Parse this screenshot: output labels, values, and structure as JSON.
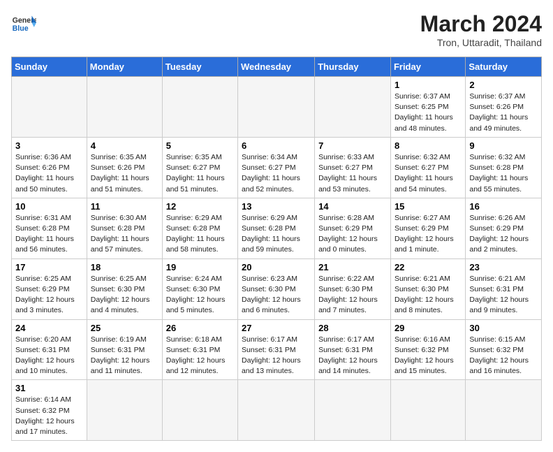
{
  "header": {
    "logo_general": "General",
    "logo_blue": "Blue",
    "month_title": "March 2024",
    "subtitle": "Tron, Uttaradit, Thailand"
  },
  "days_of_week": [
    "Sunday",
    "Monday",
    "Tuesday",
    "Wednesday",
    "Thursday",
    "Friday",
    "Saturday"
  ],
  "weeks": [
    [
      {
        "day": "",
        "info": ""
      },
      {
        "day": "",
        "info": ""
      },
      {
        "day": "",
        "info": ""
      },
      {
        "day": "",
        "info": ""
      },
      {
        "day": "",
        "info": ""
      },
      {
        "day": "1",
        "info": "Sunrise: 6:37 AM\nSunset: 6:25 PM\nDaylight: 11 hours\nand 48 minutes."
      },
      {
        "day": "2",
        "info": "Sunrise: 6:37 AM\nSunset: 6:26 PM\nDaylight: 11 hours\nand 49 minutes."
      }
    ],
    [
      {
        "day": "3",
        "info": "Sunrise: 6:36 AM\nSunset: 6:26 PM\nDaylight: 11 hours\nand 50 minutes."
      },
      {
        "day": "4",
        "info": "Sunrise: 6:35 AM\nSunset: 6:26 PM\nDaylight: 11 hours\nand 51 minutes."
      },
      {
        "day": "5",
        "info": "Sunrise: 6:35 AM\nSunset: 6:27 PM\nDaylight: 11 hours\nand 51 minutes."
      },
      {
        "day": "6",
        "info": "Sunrise: 6:34 AM\nSunset: 6:27 PM\nDaylight: 11 hours\nand 52 minutes."
      },
      {
        "day": "7",
        "info": "Sunrise: 6:33 AM\nSunset: 6:27 PM\nDaylight: 11 hours\nand 53 minutes."
      },
      {
        "day": "8",
        "info": "Sunrise: 6:32 AM\nSunset: 6:27 PM\nDaylight: 11 hours\nand 54 minutes."
      },
      {
        "day": "9",
        "info": "Sunrise: 6:32 AM\nSunset: 6:28 PM\nDaylight: 11 hours\nand 55 minutes."
      }
    ],
    [
      {
        "day": "10",
        "info": "Sunrise: 6:31 AM\nSunset: 6:28 PM\nDaylight: 11 hours\nand 56 minutes."
      },
      {
        "day": "11",
        "info": "Sunrise: 6:30 AM\nSunset: 6:28 PM\nDaylight: 11 hours\nand 57 minutes."
      },
      {
        "day": "12",
        "info": "Sunrise: 6:29 AM\nSunset: 6:28 PM\nDaylight: 11 hours\nand 58 minutes."
      },
      {
        "day": "13",
        "info": "Sunrise: 6:29 AM\nSunset: 6:28 PM\nDaylight: 11 hours\nand 59 minutes."
      },
      {
        "day": "14",
        "info": "Sunrise: 6:28 AM\nSunset: 6:29 PM\nDaylight: 12 hours\nand 0 minutes."
      },
      {
        "day": "15",
        "info": "Sunrise: 6:27 AM\nSunset: 6:29 PM\nDaylight: 12 hours\nand 1 minute."
      },
      {
        "day": "16",
        "info": "Sunrise: 6:26 AM\nSunset: 6:29 PM\nDaylight: 12 hours\nand 2 minutes."
      }
    ],
    [
      {
        "day": "17",
        "info": "Sunrise: 6:25 AM\nSunset: 6:29 PM\nDaylight: 12 hours\nand 3 minutes."
      },
      {
        "day": "18",
        "info": "Sunrise: 6:25 AM\nSunset: 6:30 PM\nDaylight: 12 hours\nand 4 minutes."
      },
      {
        "day": "19",
        "info": "Sunrise: 6:24 AM\nSunset: 6:30 PM\nDaylight: 12 hours\nand 5 minutes."
      },
      {
        "day": "20",
        "info": "Sunrise: 6:23 AM\nSunset: 6:30 PM\nDaylight: 12 hours\nand 6 minutes."
      },
      {
        "day": "21",
        "info": "Sunrise: 6:22 AM\nSunset: 6:30 PM\nDaylight: 12 hours\nand 7 minutes."
      },
      {
        "day": "22",
        "info": "Sunrise: 6:21 AM\nSunset: 6:30 PM\nDaylight: 12 hours\nand 8 minutes."
      },
      {
        "day": "23",
        "info": "Sunrise: 6:21 AM\nSunset: 6:31 PM\nDaylight: 12 hours\nand 9 minutes."
      }
    ],
    [
      {
        "day": "24",
        "info": "Sunrise: 6:20 AM\nSunset: 6:31 PM\nDaylight: 12 hours\nand 10 minutes."
      },
      {
        "day": "25",
        "info": "Sunrise: 6:19 AM\nSunset: 6:31 PM\nDaylight: 12 hours\nand 11 minutes."
      },
      {
        "day": "26",
        "info": "Sunrise: 6:18 AM\nSunset: 6:31 PM\nDaylight: 12 hours\nand 12 minutes."
      },
      {
        "day": "27",
        "info": "Sunrise: 6:17 AM\nSunset: 6:31 PM\nDaylight: 12 hours\nand 13 minutes."
      },
      {
        "day": "28",
        "info": "Sunrise: 6:17 AM\nSunset: 6:31 PM\nDaylight: 12 hours\nand 14 minutes."
      },
      {
        "day": "29",
        "info": "Sunrise: 6:16 AM\nSunset: 6:32 PM\nDaylight: 12 hours\nand 15 minutes."
      },
      {
        "day": "30",
        "info": "Sunrise: 6:15 AM\nSunset: 6:32 PM\nDaylight: 12 hours\nand 16 minutes."
      }
    ],
    [
      {
        "day": "31",
        "info": "Sunrise: 6:14 AM\nSunset: 6:32 PM\nDaylight: 12 hours\nand 17 minutes."
      },
      {
        "day": "",
        "info": ""
      },
      {
        "day": "",
        "info": ""
      },
      {
        "day": "",
        "info": ""
      },
      {
        "day": "",
        "info": ""
      },
      {
        "day": "",
        "info": ""
      },
      {
        "day": "",
        "info": ""
      }
    ]
  ]
}
